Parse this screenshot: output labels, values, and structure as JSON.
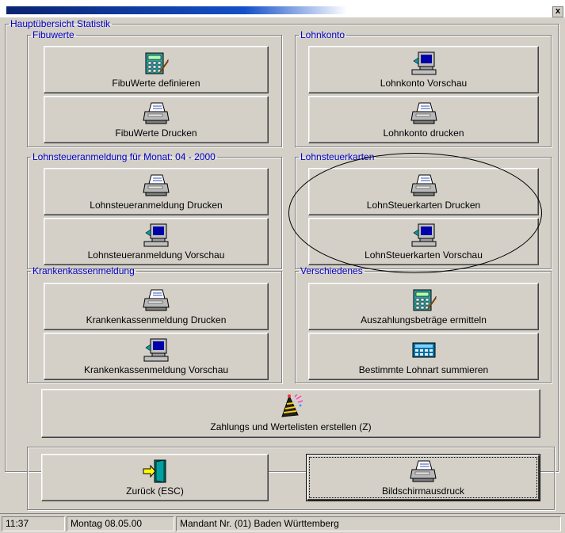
{
  "window": {
    "close_glyph": "x"
  },
  "main_group": {
    "title": "Hauptübersicht Statistik"
  },
  "groups": {
    "fibuwerte": {
      "title": "Fibuwerte",
      "btn1": {
        "label": "FibuWerte definieren",
        "icon": "calculator-icon"
      },
      "btn2": {
        "label": "FibuWerte Drucken",
        "icon": "printer-icon"
      }
    },
    "lohnkonto": {
      "title": "Lohnkonto",
      "btn1": {
        "label": "Lohnkonto Vorschau",
        "icon": "computer-icon"
      },
      "btn2": {
        "label": "Lohnkonto drucken",
        "icon": "printer-icon"
      }
    },
    "lohnsteuer": {
      "title": "Lohnsteueranmeldung für Monat: 04 - 2000",
      "btn1": {
        "label": "Lohnsteueranmeldung Drucken",
        "icon": "printer-icon"
      },
      "btn2": {
        "label": "Lohnsteueranmeldung Vorschau",
        "icon": "computer-icon"
      }
    },
    "lohnsteuerkarten": {
      "title": "Lohnsteuerkarten",
      "btn1": {
        "label": "LohnSteuerkarten Drucken",
        "icon": "printer-icon"
      },
      "btn2": {
        "label": "LohnSteuerkarten Vorschau",
        "icon": "computer-icon"
      }
    },
    "krankenkasse": {
      "title": "Krankenkassenmeldung",
      "btn1": {
        "label": "Krankenkassenmeldung Drucken",
        "icon": "printer-icon"
      },
      "btn2": {
        "label": "Krankenkassenmeldung Vorschau",
        "icon": "computer-icon"
      }
    },
    "verschiedenes": {
      "title": "Verschiedenes",
      "btn1": {
        "label": "Auszahlungsbeträge ermitteln",
        "icon": "calculator-icon"
      },
      "btn2": {
        "label": "Bestimmte Lohnart summieren",
        "icon": "keyboard-calc-icon"
      }
    }
  },
  "wide_button": {
    "label": "Zahlungs und Wertelisten erstellen (Z)",
    "icon": "party-hat-icon"
  },
  "back_button": {
    "label": "Zurück (ESC)",
    "icon": "exit-door-icon"
  },
  "print_screen_button": {
    "label": "Bildschirmausdruck",
    "icon": "printer-icon"
  },
  "status": {
    "time": "11:37",
    "date": "Montag  08.05.00",
    "client": "Mandant Nr. (01)  Baden Württemberg"
  },
  "colors": {
    "group_title": "#0000c8",
    "face": "#d4d0c8"
  }
}
